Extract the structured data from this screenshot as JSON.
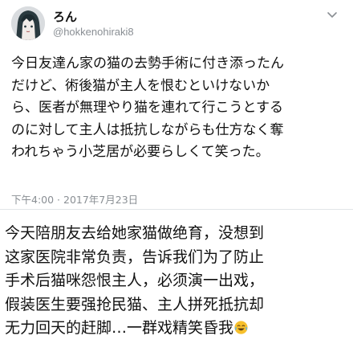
{
  "tweet": {
    "author": {
      "display_name": "ろん",
      "handle": "@hokkenohiraki8",
      "avatar_icon": "avatar-illustration-icon"
    },
    "menu_icon": "chevron-down-icon",
    "text_lines": [
      "今日友達ん家の猫の去勢手術に付き添ったん",
      "だけど、術後猫が主人を恨むといけないか",
      "ら、医者が無理やり猫を連れて行こうとする",
      "のに対して主人は抵抗しながらも仕方なく奪",
      "われちゃう小芝居が必要らしくて笑った。"
    ],
    "timestamp": "下午4:00 · 2017年7月23日"
  },
  "caption": {
    "lines": [
      "今天陪朋友去给她家猫做绝育，没想到",
      "这家医院非常负责，告诉我们为了防止",
      "手术后猫咪怨恨主人，必须演一出戏，",
      "假装医生要强抢民猫、主人拼死抵抗却",
      "无力回天的赶脚…一群戏精笑昏我"
    ],
    "emoji": "laughing-tears-emoji"
  },
  "colors": {
    "text": "#111111",
    "secondary": "#8a8f94",
    "divider": "#e1e5e8",
    "emoji": "#f7c02c"
  }
}
